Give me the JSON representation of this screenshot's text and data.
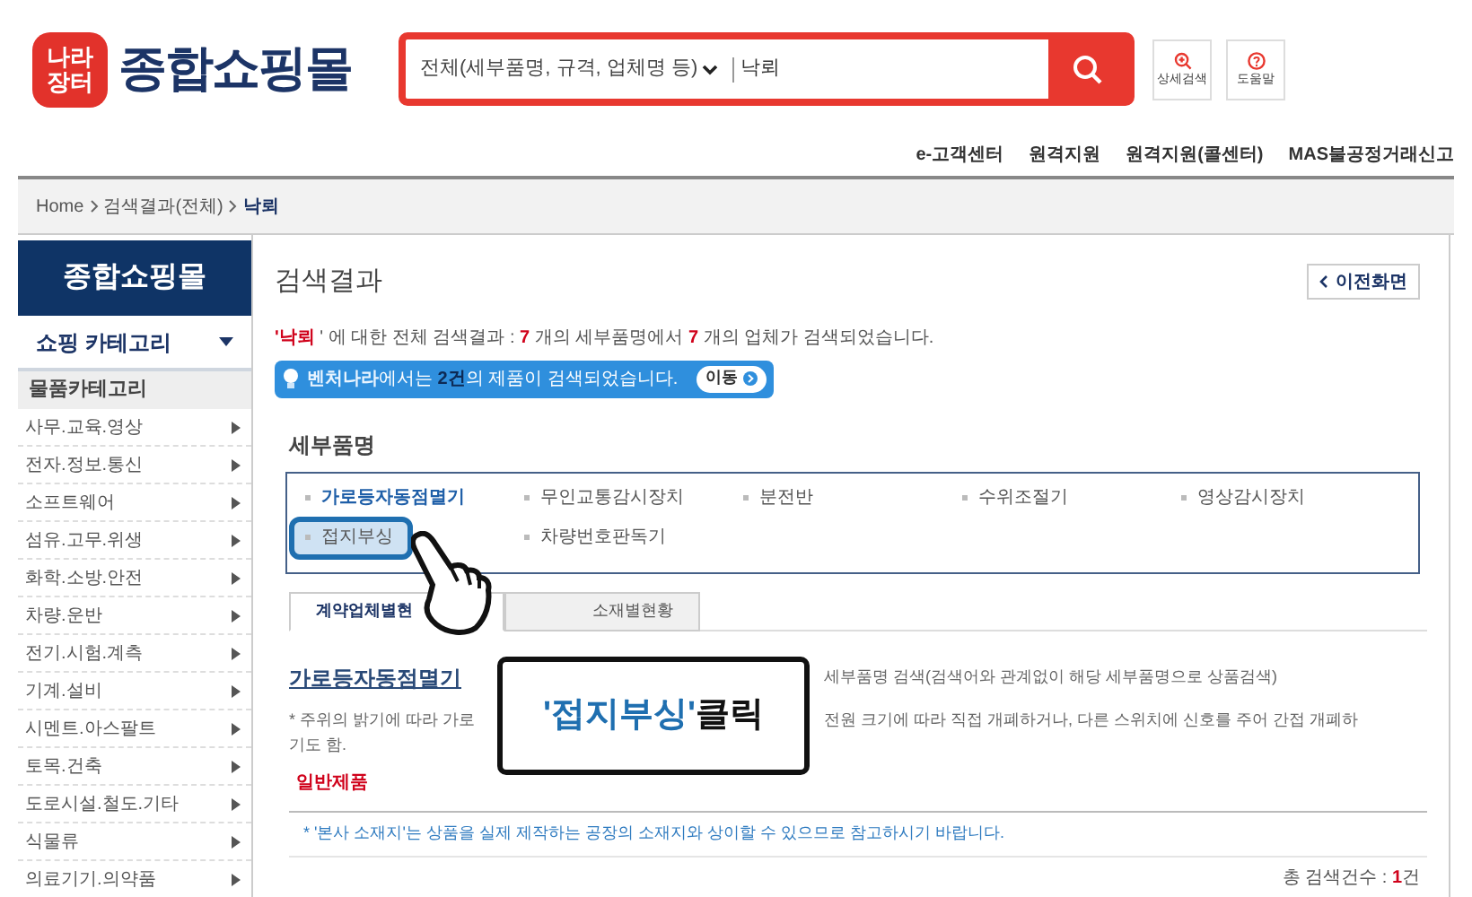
{
  "header": {
    "logo_badge": [
      "나라",
      "장터"
    ],
    "logo_text": "종합쇼핑몰",
    "search": {
      "scope": "전체(세부품명, 규격, 업체명 등)",
      "value": "낙뢰"
    },
    "tools": [
      {
        "kind": "zoom",
        "label": "상세검색"
      },
      {
        "kind": "help",
        "label": "도움말"
      }
    ]
  },
  "top_links": [
    "e-고객센터",
    "원격지원",
    "원격지원(콜센터)",
    "MAS불공정거래신고"
  ],
  "breadcrumb": [
    {
      "label": "Home",
      "current": false
    },
    {
      "label": "검색결과(전체)",
      "current": false
    },
    {
      "label": "낙뢰",
      "current": true
    }
  ],
  "sidebar": {
    "title": "종합쇼핑몰",
    "dropdown": "쇼핑 카테고리",
    "section": "물품카테고리",
    "items": [
      "사무.교육.영상",
      "전자.정보.통신",
      "소프트웨어",
      "섬유.고무.위생",
      "화학.소방.안전",
      "차량.운반",
      "전기.시험.계측",
      "기계.설비",
      "시멘트.아스팔트",
      "토목.건축",
      "도로시설.철도.기타",
      "식물류",
      "의료기기.의약품"
    ]
  },
  "page_title": "검색결과",
  "back_button": "이전화면",
  "summary": [
    {
      "text": "'낙뢰",
      "highlight": true
    },
    {
      "text": " ' 에 대한 전체 검색결과 : ",
      "highlight": false
    },
    {
      "text": "7",
      "highlight": true
    },
    {
      "text": " 개의 세부품명에서 ",
      "highlight": false
    },
    {
      "text": "7",
      "highlight": true
    },
    {
      "text": " 개의 업체가 검색되었습니다.",
      "highlight": false
    }
  ],
  "banner": {
    "parts": [
      {
        "text": "벤처나라",
        "kind": "brand"
      },
      {
        "text": "에서는 ",
        "kind": "plain"
      },
      {
        "text": "2건",
        "kind": "count"
      },
      {
        "text": "의 제품이 검색되었습니다.",
        "kind": "plain"
      }
    ],
    "button": "이동"
  },
  "category_heading": "세부품명",
  "categories": [
    {
      "label": "가로등자동점멸기",
      "selected": true,
      "highlighted": false
    },
    {
      "label": "무인교통감시장치",
      "selected": false,
      "highlighted": false
    },
    {
      "label": "분전반",
      "selected": false,
      "highlighted": false
    },
    {
      "label": "수위조절기",
      "selected": false,
      "highlighted": false
    },
    {
      "label": "영상감시장치",
      "selected": false,
      "highlighted": false
    },
    {
      "label": "접지부싱",
      "selected": false,
      "highlighted": true
    },
    {
      "label": "차량번호판독기",
      "selected": false,
      "highlighted": false
    }
  ],
  "tabs": [
    {
      "label": "계약업체별현",
      "selected": true
    },
    {
      "label": "소재별현황",
      "selected": false
    }
  ],
  "product": {
    "title": "가로등자동점멸기",
    "search_note": "세부품명 검색(검색어와 관계없이 해당 세부품명으로 상품검색)",
    "description_left": "* 주위의 밝기에 따라 가로",
    "description_right": "전원 크기에 따라 직접 개폐하거나, 다른 스위치에 신호를 주어 간접 개폐하",
    "description_end": "기도 함.",
    "type_label": "일반제품"
  },
  "notice": "* '본사 소재지'는 상품을 실제 제작하는 공장의 소재지와 상이할 수 있으므로 참고하시기 바랍니다.",
  "total": [
    {
      "text": "총 검색건수 : ",
      "highlight": false
    },
    {
      "text": "1",
      "highlight": true
    },
    {
      "text": "건",
      "highlight": false
    }
  ],
  "callout": [
    {
      "text": "'접지부싱'",
      "highlight": true
    },
    {
      "text": " 클릭",
      "highlight": false
    }
  ]
}
